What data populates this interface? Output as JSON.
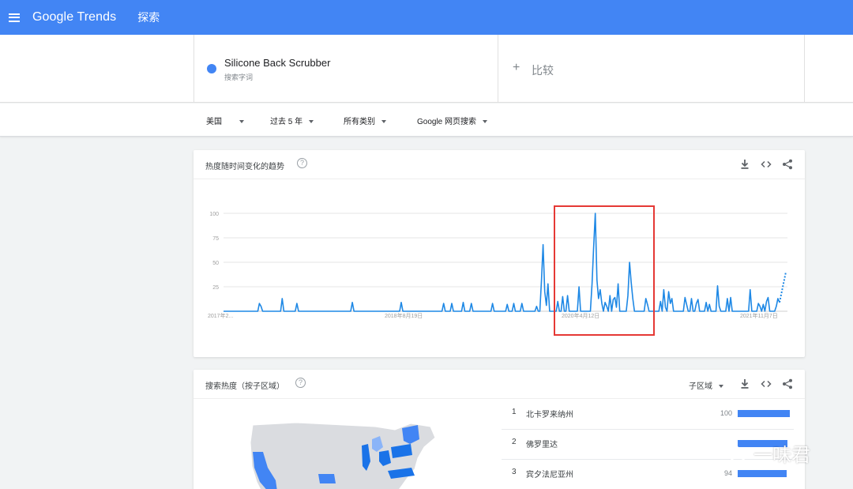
{
  "topbar": {
    "logo_google": "Google",
    "logo_trends": "Trends",
    "nav_explore": "探索",
    "color": "#4285f4"
  },
  "search_term": {
    "name": "Silicone Back Scrubber",
    "subtitle": "搜索字词",
    "dot_color": "#4285f4"
  },
  "compare": {
    "label": "比较"
  },
  "filters": {
    "region": "美国",
    "time": "过去 5 年",
    "category": "所有类别",
    "search_type": "Google 网页搜索"
  },
  "trend_card": {
    "title": "热度随时间变化的趋势",
    "help": "?"
  },
  "chart_data": {
    "type": "line",
    "title": "",
    "xlabel": "",
    "ylabel": "",
    "ylim": [
      0,
      100
    ],
    "yticks": [
      25,
      50,
      75,
      100
    ],
    "x_tick_labels": [
      "2017年2...",
      "2018年8月19日",
      "2020年4月12日",
      "2021年11月7日"
    ],
    "grid": true,
    "line_color": "#1e88e5",
    "highlight_color": "#e53935",
    "series": [
      {
        "values": [
          0,
          0,
          0,
          0,
          0,
          0,
          0,
          0,
          0,
          0,
          0,
          0,
          0,
          0,
          0,
          0,
          0,
          0,
          0,
          0,
          0,
          0,
          8,
          5,
          0,
          0,
          0,
          0,
          0,
          0,
          0,
          0,
          0,
          0,
          0,
          0,
          13,
          0,
          0,
          0,
          0,
          0,
          0,
          0,
          0,
          8,
          0,
          0,
          0,
          0,
          0,
          0,
          0,
          0,
          0,
          0,
          0,
          0,
          0,
          0,
          0,
          0,
          0,
          0,
          0,
          0,
          0,
          0,
          0,
          0,
          0,
          0,
          0,
          0,
          0,
          0,
          0,
          0,
          0,
          9,
          0,
          0,
          0,
          0,
          0,
          0,
          0,
          0,
          0,
          0,
          0,
          0,
          0,
          0,
          0,
          0,
          0,
          0,
          0,
          0,
          0,
          0,
          0,
          0,
          0,
          0,
          0,
          0,
          0,
          9,
          0,
          0,
          0,
          0,
          0,
          0,
          0,
          0,
          0,
          0,
          0,
          0,
          0,
          0,
          0,
          0,
          0,
          0,
          0,
          0,
          0,
          0,
          0,
          0,
          0,
          8,
          0,
          0,
          0,
          0,
          8,
          0,
          0,
          0,
          0,
          0,
          0,
          9,
          0,
          0,
          0,
          0,
          8,
          0,
          0,
          0,
          0,
          0,
          0,
          0,
          0,
          0,
          0,
          0,
          0,
          8,
          0,
          0,
          0,
          0,
          0,
          0,
          0,
          0,
          7,
          0,
          0,
          0,
          8,
          0,
          0,
          0,
          0,
          8,
          0,
          0,
          0,
          0,
          0,
          0,
          0,
          0,
          5,
          0,
          0,
          32,
          68,
          20,
          6,
          28,
          0,
          0,
          0,
          0,
          0,
          10,
          0,
          0,
          15,
          0,
          0,
          16,
          0,
          0,
          0,
          0,
          0,
          0,
          25,
          0,
          0,
          0,
          0,
          0,
          0,
          0,
          28,
          65,
          100,
          32,
          13,
          22,
          8,
          0,
          9,
          5,
          0,
          16,
          0,
          12,
          14,
          4,
          28,
          0,
          0,
          0,
          0,
          0,
          16,
          50,
          30,
          13,
          0,
          0,
          0,
          0,
          0,
          0,
          0,
          13,
          7,
          0,
          0,
          0,
          0,
          0,
          0,
          0,
          10,
          0,
          22,
          4,
          0,
          20,
          8,
          13,
          0,
          0,
          0,
          0,
          0,
          0,
          0,
          14,
          7,
          0,
          0,
          13,
          0,
          0,
          8,
          12,
          0,
          0,
          0,
          0,
          9,
          0,
          7,
          0,
          0,
          0,
          0,
          26,
          5,
          0,
          0,
          0,
          0,
          13,
          0,
          14,
          0,
          0,
          0,
          0,
          0,
          0,
          0,
          0,
          0,
          0,
          0,
          22,
          0,
          0,
          0,
          0,
          8,
          5,
          0,
          7,
          0,
          10,
          14,
          0,
          0,
          0,
          0,
          5,
          13,
          9
        ],
        "partial_end_values": [
          9,
          40
        ]
      }
    ]
  },
  "region_card": {
    "title": "搜索热度（按子区域）",
    "help": "?",
    "subregion_label": "子区域",
    "rows": [
      {
        "rank": "1",
        "name": "北卡罗来纳州",
        "value": "100",
        "score": 100
      },
      {
        "rank": "2",
        "name": "佛罗里达",
        "value": "",
        "score": 95
      },
      {
        "rank": "3",
        "name": "宾夕法尼亚州",
        "value": "94",
        "score": 94
      }
    ]
  },
  "watermark": {
    "text": "一味君"
  },
  "map_colors": {
    "light": "#dadce0",
    "medium": "#8ab4f8",
    "strong": "#4285f4",
    "strongest": "#1a73e8"
  }
}
